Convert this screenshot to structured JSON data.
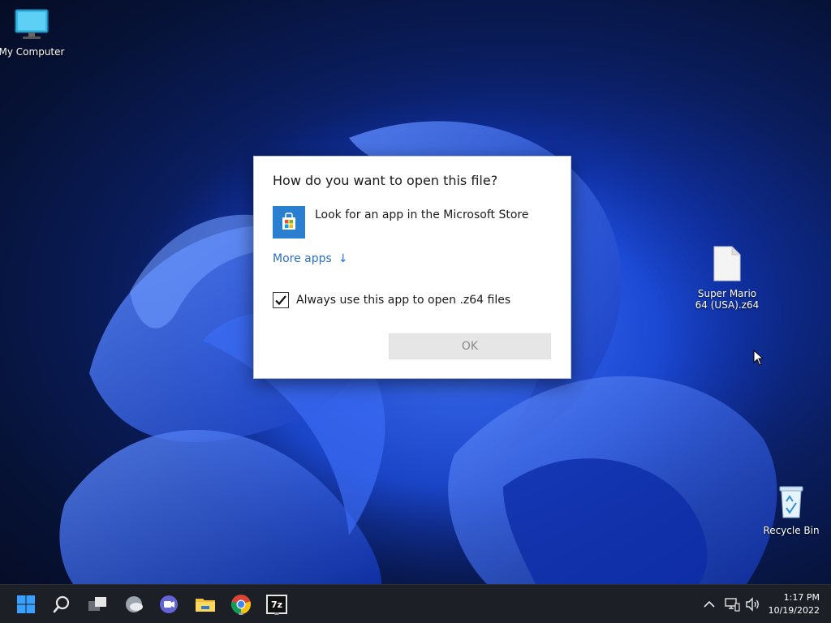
{
  "desktop": {
    "icons": [
      {
        "label": "My Computer",
        "icon": "computer-icon"
      },
      {
        "label": "Super Mario 64 (USA).z64",
        "line1": "Super Mario",
        "line2": "64 (USA).z64",
        "icon": "file-icon"
      },
      {
        "label": "Recycle Bin",
        "icon": "recycle-bin-icon"
      }
    ]
  },
  "dialog": {
    "title": "How do you want to open this file?",
    "store_option": "Look for an app in the Microsoft Store",
    "more_apps": "More apps",
    "more_apps_arrow": "↓",
    "always_use": "Always use this app to open .z64 files",
    "always_use_checked": true,
    "ok_label": "OK"
  },
  "taskbar": {
    "items": [
      {
        "name": "start-button",
        "icon": "windows-logo-icon"
      },
      {
        "name": "search-button",
        "icon": "search-icon"
      },
      {
        "name": "task-view-button",
        "icon": "task-view-icon"
      },
      {
        "name": "widgets-button",
        "icon": "weather-icon"
      },
      {
        "name": "chat-button",
        "icon": "teams-chat-icon"
      },
      {
        "name": "file-explorer-button",
        "icon": "folder-icon"
      },
      {
        "name": "chrome-button",
        "icon": "chrome-icon"
      },
      {
        "name": "7zip-button",
        "icon": "7zip-icon",
        "text": "7z"
      }
    ],
    "clock": {
      "time": "1:17 PM",
      "date": "10/19/2022"
    }
  },
  "colors": {
    "accent": "#2a6fc9",
    "store_tile": "#2a7fd1",
    "taskbar": "#1c1f26"
  }
}
